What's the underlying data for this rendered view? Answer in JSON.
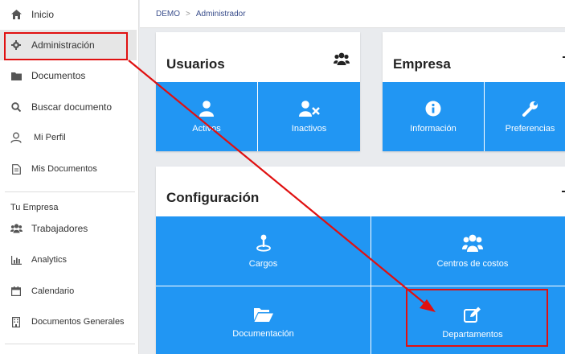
{
  "sidebar": {
    "items": [
      {
        "label": "Inicio",
        "icon": "home-icon"
      },
      {
        "label": "Administración",
        "icon": "gear-icon"
      },
      {
        "label": "Documentos",
        "icon": "folder-icon"
      },
      {
        "label": "Buscar documento",
        "icon": "search-icon"
      },
      {
        "label": "Mi Perfil",
        "icon": "user-icon"
      },
      {
        "label": "Mis Documentos",
        "icon": "document-icon"
      }
    ],
    "section_label": "Tu Empresa",
    "company_items": [
      {
        "label": "Trabajadores",
        "icon": "users-icon"
      },
      {
        "label": "Analytics",
        "icon": "bar-chart-icon"
      },
      {
        "label": "Calendario",
        "icon": "calendar-icon"
      },
      {
        "label": "Documentos Generales",
        "icon": "building-icon"
      }
    ]
  },
  "breadcrumb": {
    "root": "DEMO",
    "separator": ">",
    "current": "Administrador"
  },
  "cards": {
    "usuarios": {
      "title": "Usuarios",
      "tiles": [
        {
          "label": "Activos",
          "icon": "user-icon"
        },
        {
          "label": "Inactivos",
          "icon": "user-remove-icon"
        }
      ]
    },
    "empresa": {
      "title": "Empresa",
      "tiles": [
        {
          "label": "Información",
          "icon": "info-icon"
        },
        {
          "label": "Preferencias",
          "icon": "wrench-icon"
        }
      ]
    },
    "configuracion": {
      "title": "Configuración",
      "tiles": [
        {
          "label": "Cargos",
          "icon": "pin-icon"
        },
        {
          "label": "Centros de costos",
          "icon": "group-icon"
        },
        {
          "label": "Documentación",
          "icon": "folder-open-icon"
        },
        {
          "label": "Departamentos",
          "icon": "edit-icon"
        }
      ]
    }
  },
  "colors": {
    "tile_blue": "#2196f3",
    "annotation_red": "#e01010",
    "breadcrumb_text": "#3a4e8c"
  }
}
